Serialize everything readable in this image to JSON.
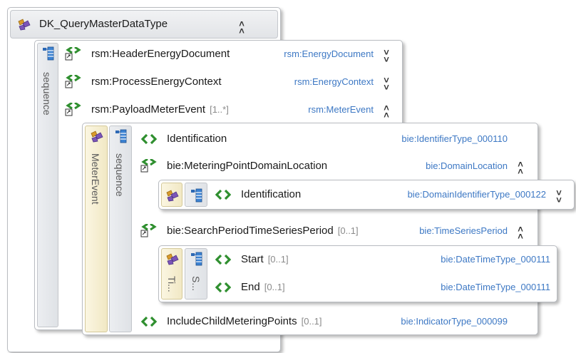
{
  "root": {
    "title": "DK_QueryMasterDataType",
    "sequence_label": "sequence",
    "elements": [
      {
        "name": "rsm:HeaderEnergyDocument",
        "cardinality": "",
        "type": "rsm:EnergyDocument"
      },
      {
        "name": "rsm:ProcessEnergyContext",
        "cardinality": "",
        "type": "rsm:EnergyContext"
      },
      {
        "name": "rsm:PayloadMeterEvent",
        "cardinality": "[1..*]",
        "type": "rsm:MeterEvent"
      }
    ]
  },
  "meter_event": {
    "label": "MeterEvent",
    "sequence_label": "sequence",
    "elements": [
      {
        "name": "Identification",
        "cardinality": "",
        "type": "bie:IdentifierType_000110"
      },
      {
        "name": "bie:MeteringPointDomainLocation",
        "cardinality": "",
        "type": "bie:DomainLocation"
      },
      {
        "name": "bie:SearchPeriodTimeSeriesPeriod",
        "cardinality": "[0..1]",
        "type": "bie:TimeSeriesPeriod"
      },
      {
        "name": "IncludeChildMeteringPoints",
        "cardinality": "[0..1]",
        "type": "bie:IndicatorType_000099"
      }
    ]
  },
  "domain_location": {
    "elements": [
      {
        "name": "Identification",
        "cardinality": "",
        "type": "bie:DomainIdentifierType_000122"
      }
    ]
  },
  "time_series_period": {
    "label": "Ti...",
    "sequence_label": "S...",
    "elements": [
      {
        "name": "Start",
        "cardinality": "[0..1]",
        "type": "bie:DateTimeType_000111"
      },
      {
        "name": "End",
        "cardinality": "[0..1]",
        "type": "bie:DateTimeType_000111"
      }
    ]
  },
  "icons": {
    "complex_type": "complex-type-icon",
    "sequence": "sequence-icon",
    "element_ref": "element-reference-icon",
    "element": "element-icon",
    "expand": "chevron-up-icon",
    "collapse": "chevron-down-icon"
  },
  "colors": {
    "type_link": "#3d78c4",
    "element_green": "#2f8f2f",
    "complex_type_yellow": "#f1e8c4",
    "sequence_gray": "#dfe2e6"
  }
}
